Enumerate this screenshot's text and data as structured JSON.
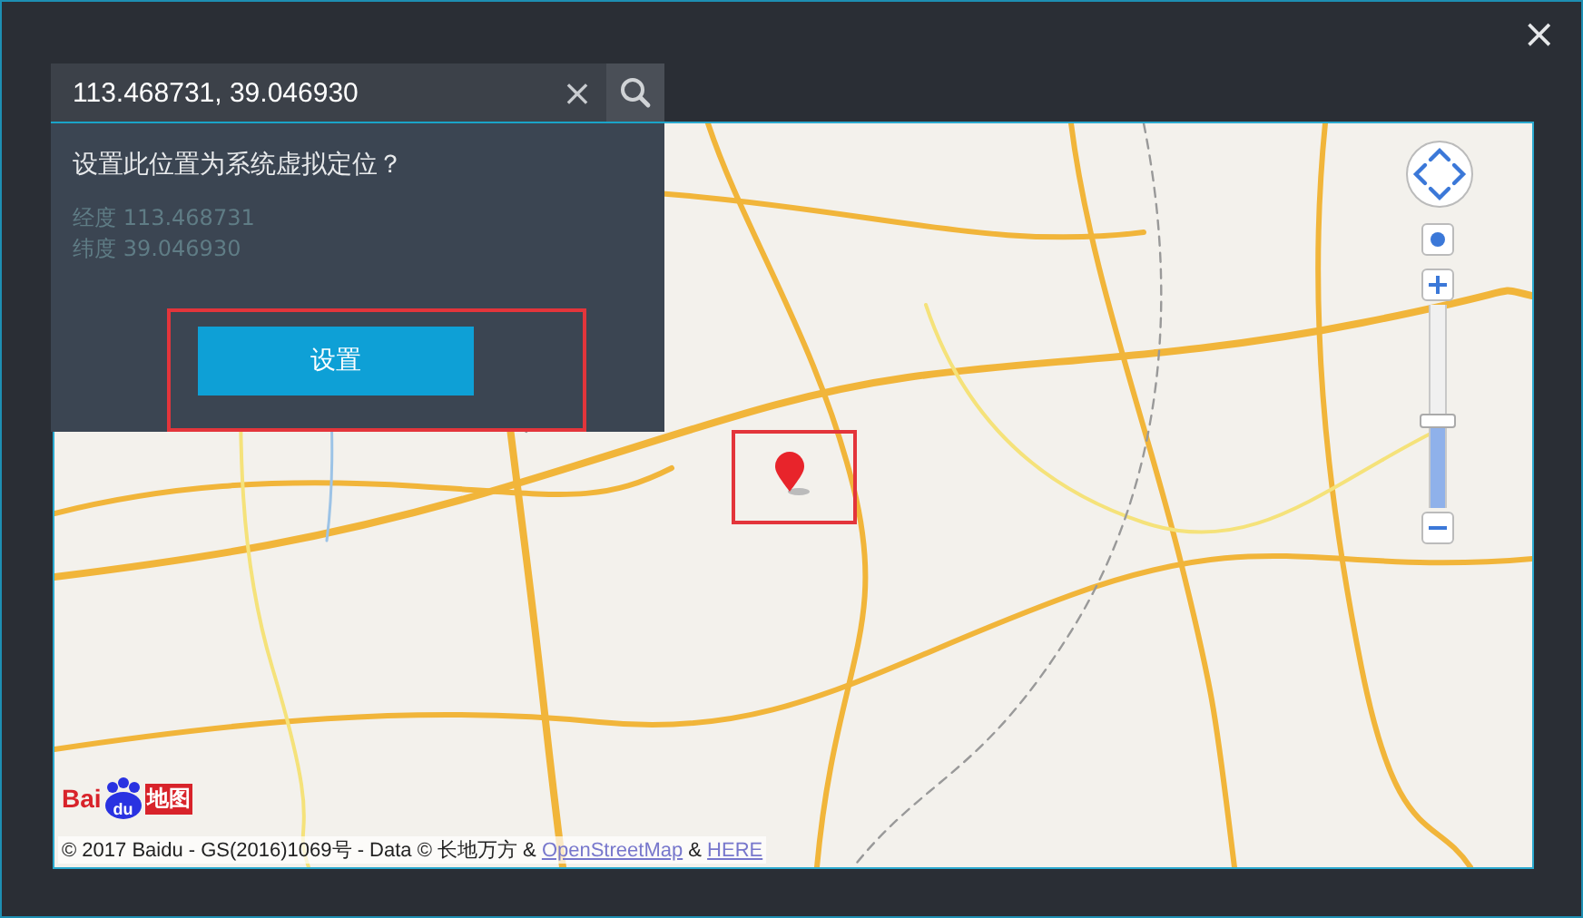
{
  "window": {
    "close": "×"
  },
  "search": {
    "value": "113.468731, 39.046930",
    "clear": "×"
  },
  "panel": {
    "question": "设置此位置为系统虚拟定位？",
    "coordinates": [
      "经度 113.468731",
      "纬度 39.046930"
    ],
    "button": "设置"
  },
  "map": {
    "zoom": {
      "level": 0.42
    },
    "logo": {
      "left": "Bai",
      "paw": "du",
      "right": "地图"
    },
    "attribution": [
      {
        "kind": "text",
        "text": "© 2017 Baidu - GS(2016)1069号 - Data © 长地万方 & "
      },
      {
        "kind": "link",
        "text": "OpenStreetMap"
      },
      {
        "kind": "text",
        "text": " & "
      },
      {
        "kind": "link",
        "text": "HERE"
      }
    ]
  }
}
